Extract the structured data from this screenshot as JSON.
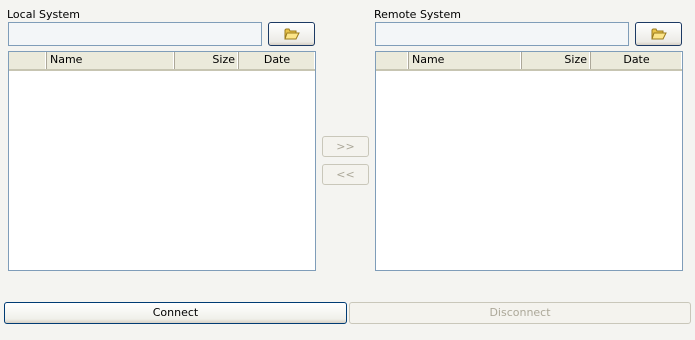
{
  "local": {
    "label": "Local System",
    "path_value": "",
    "browse_icon": "folder-icon",
    "columns": [
      "",
      "Name",
      "Size",
      "Date"
    ]
  },
  "remote": {
    "label": "Remote System",
    "path_value": "",
    "browse_icon": "folder-icon",
    "columns": [
      "",
      "Name",
      "Size",
      "Date"
    ]
  },
  "transfer": {
    "upload_label": ">>",
    "download_label": "<<"
  },
  "actions": {
    "connect_label": "Connect",
    "disconnect_label": "Disconnect"
  },
  "colors": {
    "background": "#f4f4f1",
    "input_border": "#7f9db9",
    "header_bg": "#ebeadb",
    "disabled_text": "#aca899",
    "button_border": "#003c74"
  }
}
